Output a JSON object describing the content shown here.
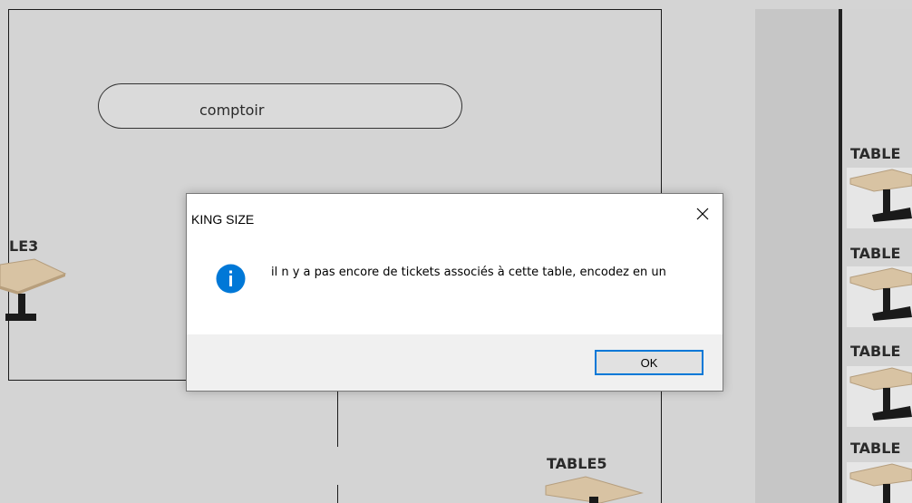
{
  "floor_plan": {
    "counter_label": "comptoir",
    "tables": [
      {
        "label": "LE3"
      },
      {
        "label": "TABLE5"
      }
    ],
    "side_panel": {
      "items": [
        {
          "label": "TABLE"
        },
        {
          "label": "TABLE"
        },
        {
          "label": "TABLE"
        },
        {
          "label": "TABLE"
        }
      ]
    }
  },
  "dialog": {
    "title": "KING SIZE",
    "icon": "info-icon",
    "message": "il n y a pas encore de tickets associés à cette table, encodez en un",
    "ok_label": "OK",
    "accent_color": "#0078d7"
  }
}
